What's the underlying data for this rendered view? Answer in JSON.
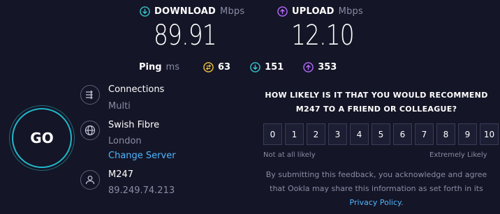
{
  "download": {
    "label": "DOWNLOAD",
    "unit": "Mbps",
    "value": "89.91",
    "icon": "download-circle-icon",
    "color": "#36c5c9"
  },
  "upload": {
    "label": "UPLOAD",
    "unit": "Mbps",
    "value": "12.10",
    "icon": "upload-circle-icon",
    "color": "#b56bff"
  },
  "ping": {
    "label": "Ping",
    "unit": "ms",
    "idle": "63",
    "down": "151",
    "up": "353",
    "idle_color": "#f3c53d",
    "down_color": "#36c5c9",
    "up_color": "#b56bff"
  },
  "go": {
    "label": "GO",
    "ring_color": "#20b7c9"
  },
  "connections": {
    "title": "Connections",
    "mode": "Multi",
    "icon": "connections-icon"
  },
  "server": {
    "name": "Swish Fibre",
    "location": "London",
    "change_label": "Change Server",
    "icon": "globe-icon"
  },
  "provider": {
    "name": "M247",
    "ip": "89.249.74.213",
    "icon": "user-icon"
  },
  "survey": {
    "question": "HOW LIKELY IS IT THAT YOU WOULD RECOMMEND M247 TO A FRIEND OR COLLEAGUE?",
    "scale": [
      "0",
      "1",
      "2",
      "3",
      "4",
      "5",
      "6",
      "7",
      "8",
      "9",
      "10"
    ],
    "low_label": "Not at all likely",
    "high_label": "Extremely Likely",
    "disclaimer_prefix": "By submitting this feedback, you acknowledge and agree that Ookla may share this information as set forth in its ",
    "privacy_link": "Privacy Policy",
    "disclaimer_suffix": "."
  }
}
